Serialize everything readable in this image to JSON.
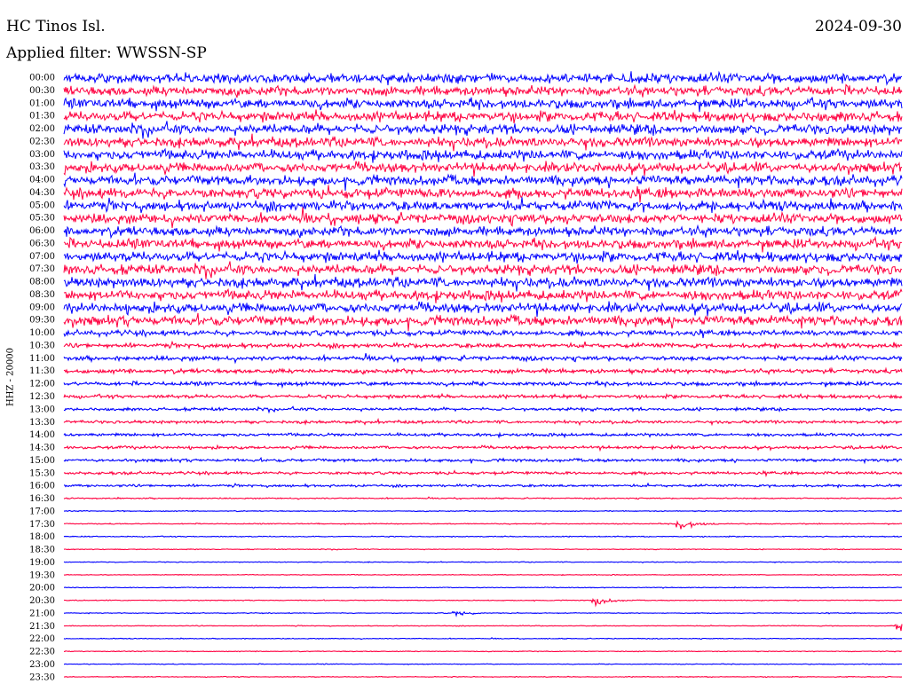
{
  "header": {
    "station": "HC Tinos Isl.",
    "date": "2024-09-30",
    "filter": "Applied filter: WWSSN-SP"
  },
  "chart_data": {
    "type": "line",
    "title": "HC Tinos Isl.",
    "date": "2024-09-30",
    "filter": "Applied filter: WWSSN-SP",
    "ylabel": "HHZ - 20000",
    "rows": [
      "00:00",
      "00:30",
      "01:00",
      "01:30",
      "02:00",
      "02:30",
      "03:00",
      "03:30",
      "04:00",
      "04:30",
      "05:00",
      "05:30",
      "06:00",
      "06:30",
      "07:00",
      "07:30",
      "08:00",
      "08:30",
      "09:00",
      "09:30",
      "10:00",
      "10:30",
      "11:00",
      "11:30",
      "12:00",
      "12:30",
      "13:00",
      "13:30",
      "14:00",
      "14:30",
      "15:00",
      "15:30",
      "16:00",
      "16:30",
      "17:00",
      "17:30",
      "18:00",
      "18:30",
      "19:00",
      "19:30",
      "20:00",
      "20:30",
      "21:00",
      "21:30",
      "22:00",
      "22:30",
      "23:00",
      "23:30"
    ],
    "colors": [
      "#0000ff",
      "#ff0040"
    ],
    "relative_amplitude": [
      1.0,
      1.0,
      1.0,
      1.0,
      1.0,
      1.0,
      1.0,
      1.0,
      1.0,
      1.0,
      1.0,
      1.0,
      1.0,
      1.0,
      1.0,
      1.0,
      1.0,
      1.0,
      1.0,
      1.0,
      0.55,
      0.45,
      0.45,
      0.45,
      0.4,
      0.35,
      0.3,
      0.3,
      0.3,
      0.3,
      0.3,
      0.28,
      0.25,
      0.12,
      0.1,
      0.1,
      0.1,
      0.08,
      0.08,
      0.08,
      0.08,
      0.08,
      0.08,
      0.08,
      0.08,
      0.08,
      0.08,
      0.08
    ],
    "events": [
      {
        "row": "17:30",
        "minute": 22,
        "amplitude": 1.0
      },
      {
        "row": "20:30",
        "minute": 19,
        "amplitude": 0.7
      },
      {
        "row": "21:00",
        "minute": 14,
        "amplitude": 0.4
      },
      {
        "row": "21:30",
        "minute": 29.8,
        "amplitude": 0.6
      }
    ],
    "grid": false
  }
}
